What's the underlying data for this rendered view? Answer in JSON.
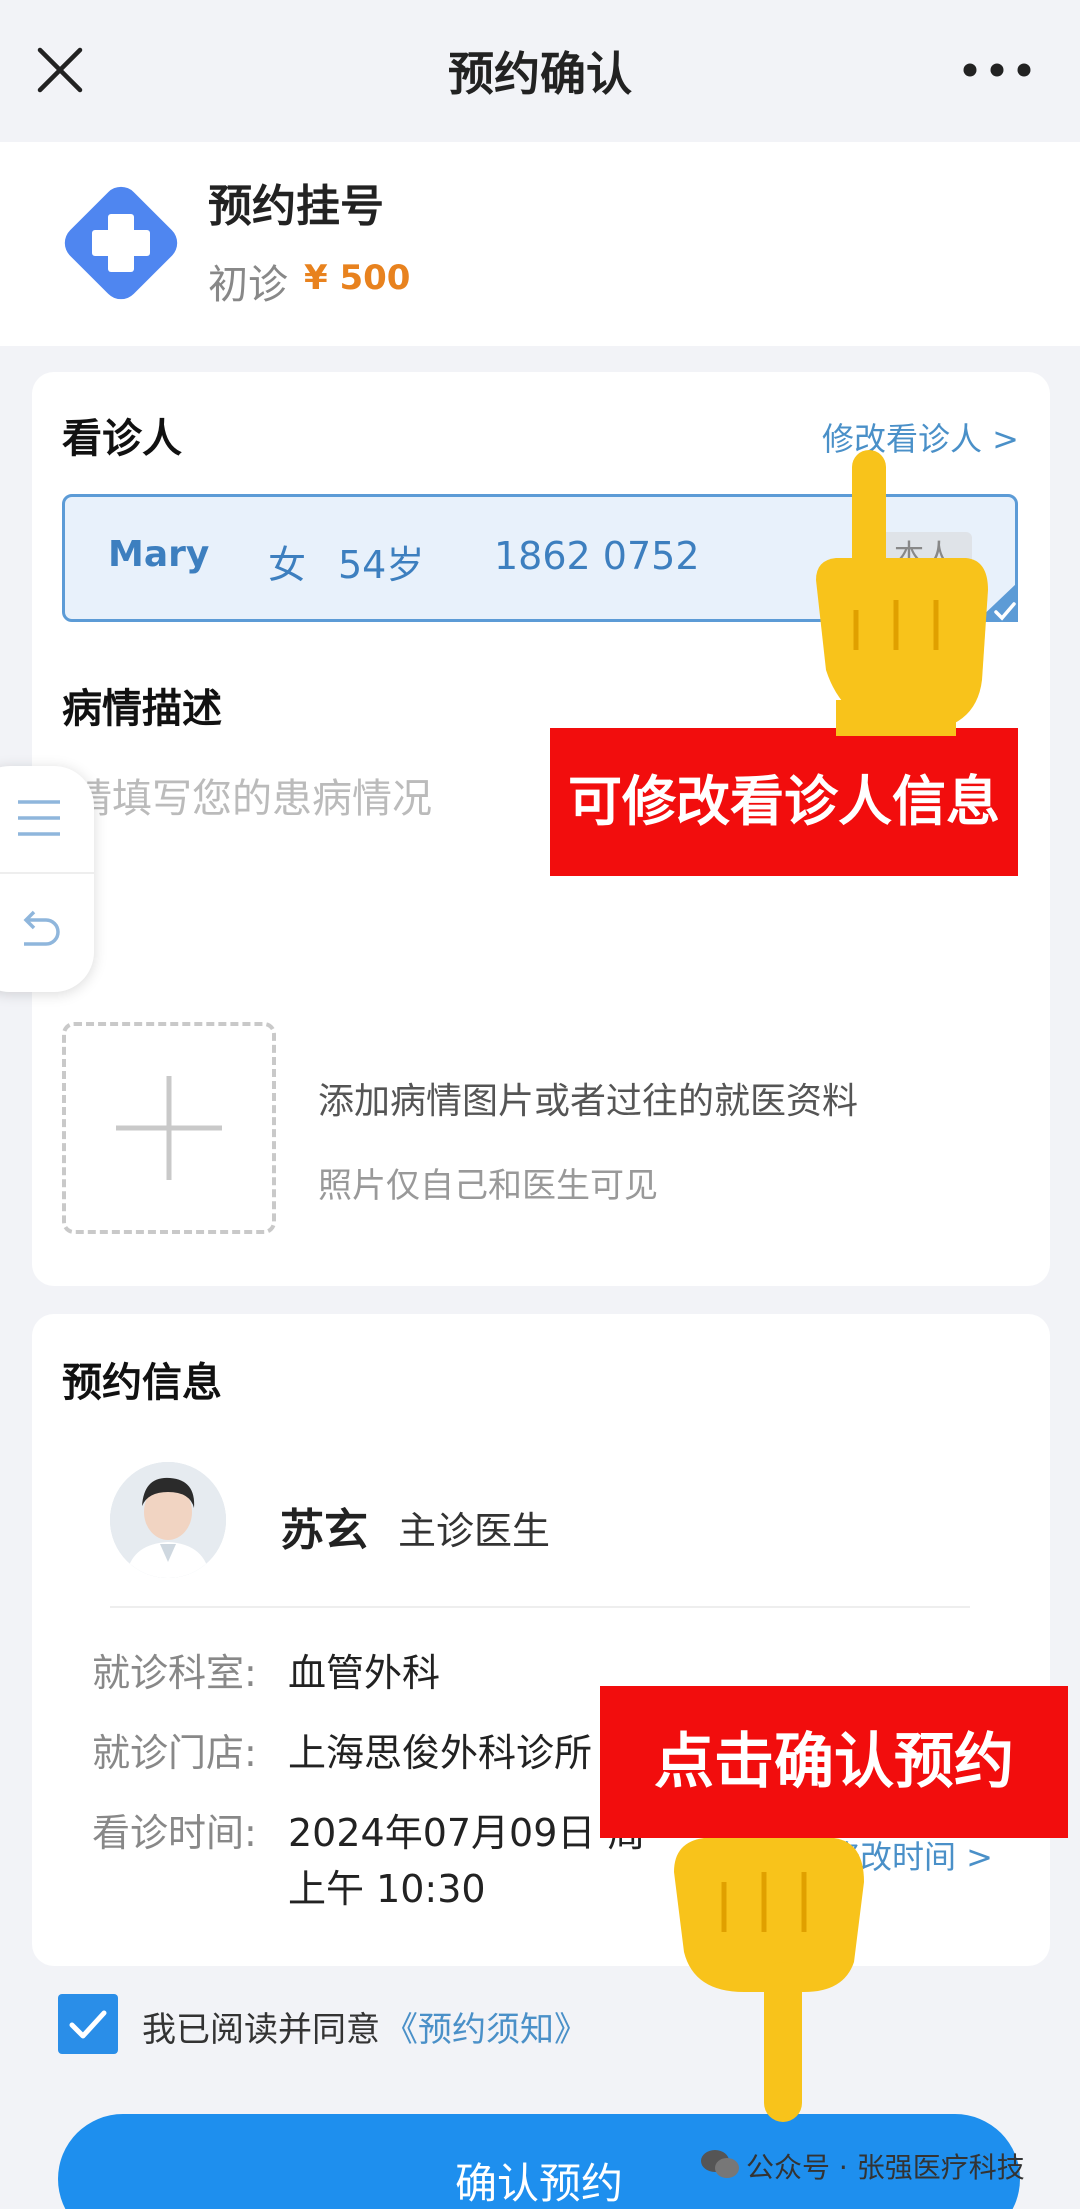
{
  "header": {
    "title": "预约确认"
  },
  "service": {
    "title": "预约挂号",
    "type": "初诊",
    "price": "¥ 500"
  },
  "patient_section": {
    "title": "看诊人",
    "edit_link": "修改看诊人 >",
    "patient": {
      "name": "Mary",
      "gender": "女",
      "age": "54岁",
      "phone": "1862  0752",
      "tag": "本人"
    }
  },
  "description_section": {
    "title": "病情描述",
    "placeholder": "请填写您的患病情况",
    "upload_text": "添加病情图片或者过往的就医资料",
    "upload_hint": "照片仅自己和医生可见"
  },
  "appointment": {
    "title": "预约信息",
    "doctor_name": "苏玄",
    "doctor_role": "主诊医生",
    "department_label": "就诊科室:",
    "department": "血管外科",
    "clinic_label": "就诊门店:",
    "clinic": "上海思俊外科诊所",
    "time_label": "看诊时间:",
    "date": "2024年07月09日 周",
    "time": "上午 10:30",
    "edit_time": "修改时间 >"
  },
  "agreement": {
    "text": "我已阅读并同意",
    "link": "《预约须知》"
  },
  "confirm_button": {
    "label": "确认预约"
  },
  "annotations": {
    "banner_edit": "可修改看诊人信息",
    "banner_confirm": "点击确认预约"
  },
  "watermark": "公众号 · 张强医疗科技",
  "colors": {
    "primary": "#1e8fee",
    "price": "#e8821e",
    "link": "#4a90c8",
    "banner": "#f20d0d"
  },
  "icons": [
    "close-icon",
    "more-icon",
    "medical-cross-icon",
    "checkmark-icon",
    "plus-icon",
    "menu-icon",
    "back-icon",
    "pointing-hand-icon",
    "wechat-icon"
  ]
}
